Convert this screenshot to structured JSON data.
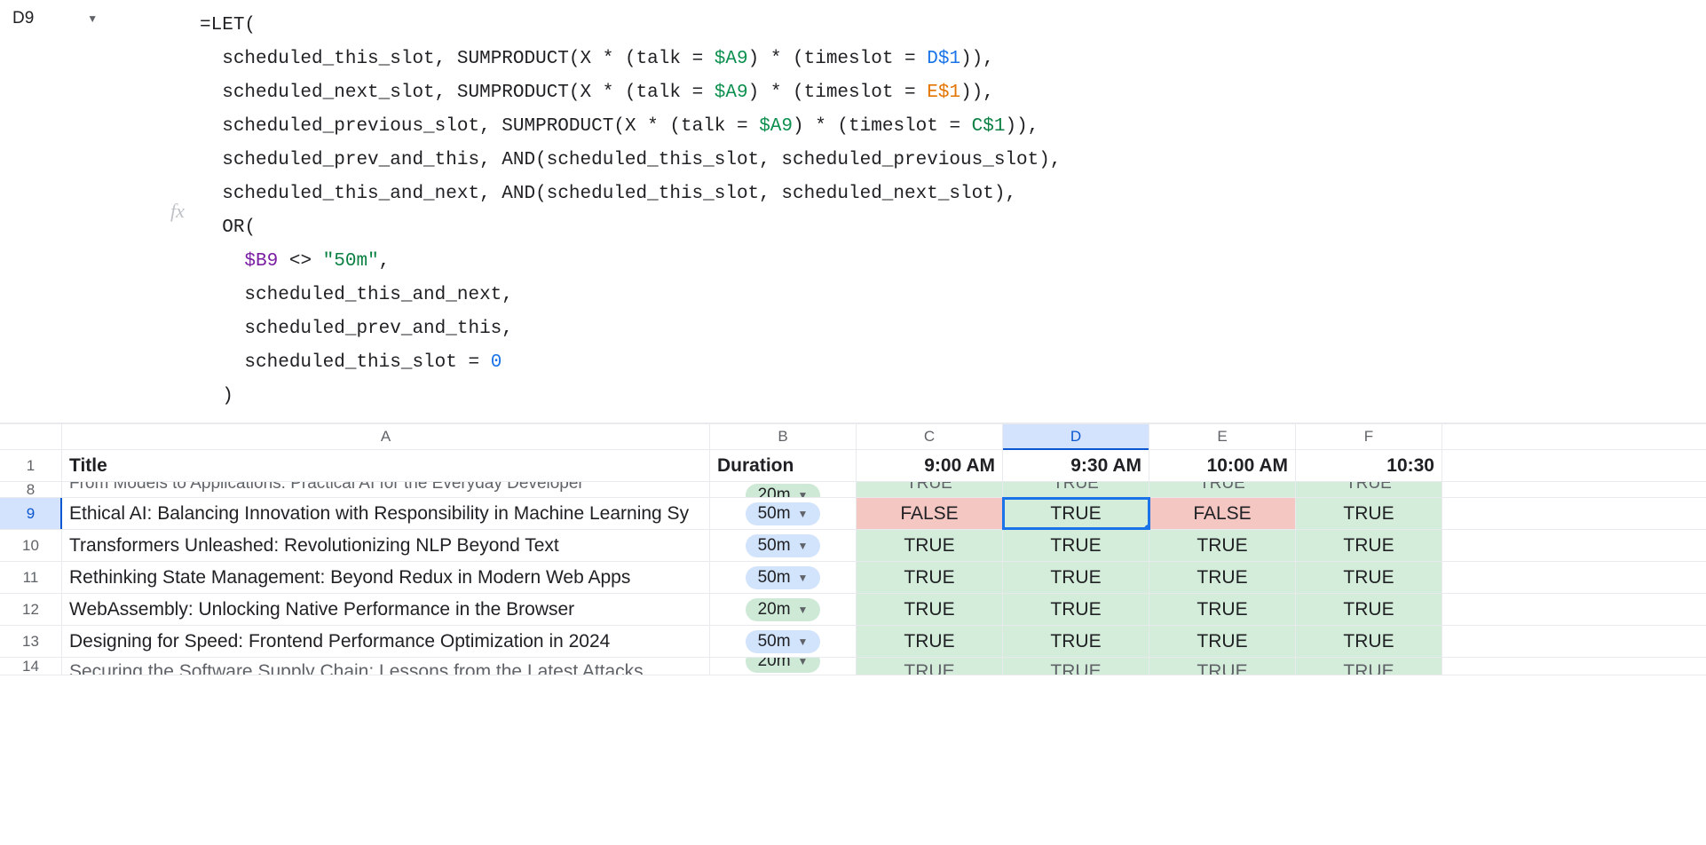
{
  "name_box": "D9",
  "formula": {
    "lines": [
      {
        "indent": 0,
        "parts": [
          {
            "t": "op",
            "v": "="
          },
          {
            "t": "fn",
            "v": "LET"
          },
          {
            "t": "op",
            "v": "("
          }
        ]
      },
      {
        "indent": 1,
        "parts": [
          {
            "t": "var",
            "v": "scheduled_this_slot"
          },
          {
            "t": "op",
            "v": ", "
          },
          {
            "t": "fn",
            "v": "SUMPRODUCT"
          },
          {
            "t": "op",
            "v": "("
          },
          {
            "t": "var",
            "v": "X"
          },
          {
            "t": "op",
            "v": " * ("
          },
          {
            "t": "var",
            "v": "talk"
          },
          {
            "t": "op",
            "v": " = "
          },
          {
            "t": "cellref-teal",
            "v": "$A9"
          },
          {
            "t": "op",
            "v": ") * ("
          },
          {
            "t": "var",
            "v": "timeslot"
          },
          {
            "t": "op",
            "v": " = "
          },
          {
            "t": "cellref-blue",
            "v": "D$1"
          },
          {
            "t": "op",
            "v": ")),"
          }
        ]
      },
      {
        "indent": 1,
        "parts": [
          {
            "t": "var",
            "v": "scheduled_next_slot"
          },
          {
            "t": "op",
            "v": ", "
          },
          {
            "t": "fn",
            "v": "SUMPRODUCT"
          },
          {
            "t": "op",
            "v": "("
          },
          {
            "t": "var",
            "v": "X"
          },
          {
            "t": "op",
            "v": " * ("
          },
          {
            "t": "var",
            "v": "talk"
          },
          {
            "t": "op",
            "v": " = "
          },
          {
            "t": "cellref-teal",
            "v": "$A9"
          },
          {
            "t": "op",
            "v": ") * ("
          },
          {
            "t": "var",
            "v": "timeslot"
          },
          {
            "t": "op",
            "v": " = "
          },
          {
            "t": "cellref-gold",
            "v": "E$1"
          },
          {
            "t": "op",
            "v": ")),"
          }
        ]
      },
      {
        "indent": 1,
        "parts": [
          {
            "t": "var",
            "v": "scheduled_previous_slot"
          },
          {
            "t": "op",
            "v": ", "
          },
          {
            "t": "fn",
            "v": "SUMPRODUCT"
          },
          {
            "t": "op",
            "v": "("
          },
          {
            "t": "var",
            "v": "X"
          },
          {
            "t": "op",
            "v": " * ("
          },
          {
            "t": "var",
            "v": "talk"
          },
          {
            "t": "op",
            "v": " = "
          },
          {
            "t": "cellref-teal",
            "v": "$A9"
          },
          {
            "t": "op",
            "v": ") * ("
          },
          {
            "t": "var",
            "v": "timeslot"
          },
          {
            "t": "op",
            "v": " = "
          },
          {
            "t": "cellref-green",
            "v": "C$1"
          },
          {
            "t": "op",
            "v": ")),"
          }
        ]
      },
      {
        "indent": 1,
        "parts": [
          {
            "t": "var",
            "v": "scheduled_prev_and_this"
          },
          {
            "t": "op",
            "v": ", "
          },
          {
            "t": "fn",
            "v": "AND"
          },
          {
            "t": "op",
            "v": "("
          },
          {
            "t": "var",
            "v": "scheduled_this_slot"
          },
          {
            "t": "op",
            "v": ", "
          },
          {
            "t": "var",
            "v": "scheduled_previous_slot"
          },
          {
            "t": "op",
            "v": "),"
          }
        ]
      },
      {
        "indent": 1,
        "parts": [
          {
            "t": "var",
            "v": "scheduled_this_and_next"
          },
          {
            "t": "op",
            "v": ", "
          },
          {
            "t": "fn",
            "v": "AND"
          },
          {
            "t": "op",
            "v": "("
          },
          {
            "t": "var",
            "v": "scheduled_this_slot"
          },
          {
            "t": "op",
            "v": ", "
          },
          {
            "t": "var",
            "v": "scheduled_next_slot"
          },
          {
            "t": "op",
            "v": "),"
          }
        ]
      },
      {
        "indent": 1,
        "parts": [
          {
            "t": "fn",
            "v": "OR"
          },
          {
            "t": "op",
            "v": "("
          }
        ]
      },
      {
        "indent": 2,
        "parts": [
          {
            "t": "cellref-purple",
            "v": "$B9"
          },
          {
            "t": "op",
            "v": " <> "
          },
          {
            "t": "str",
            "v": "\"50m\""
          },
          {
            "t": "op",
            "v": ","
          }
        ]
      },
      {
        "indent": 2,
        "parts": [
          {
            "t": "var",
            "v": "scheduled_this_and_next"
          },
          {
            "t": "op",
            "v": ","
          }
        ]
      },
      {
        "indent": 2,
        "parts": [
          {
            "t": "var",
            "v": "scheduled_prev_and_this"
          },
          {
            "t": "op",
            "v": ","
          }
        ]
      },
      {
        "indent": 2,
        "parts": [
          {
            "t": "var",
            "v": "scheduled_this_slot"
          },
          {
            "t": "op",
            "v": " = "
          },
          {
            "t": "num",
            "v": "0"
          }
        ]
      },
      {
        "indent": 1,
        "parts": [
          {
            "t": "op",
            "v": ")"
          }
        ]
      }
    ]
  },
  "columns": [
    "A",
    "B",
    "C",
    "D",
    "E",
    "F"
  ],
  "selected_column": "D",
  "header_row": {
    "num": "1",
    "title": "Title",
    "duration": "Duration",
    "c": "9:00 AM",
    "d": "9:30 AM",
    "e": "10:00 AM",
    "f": "10:30"
  },
  "clipped_row": {
    "num": "8",
    "title": "From Models to Applications: Practical AI for the Everyday Developer",
    "duration": "20m",
    "c": "TRUE",
    "d": "TRUE",
    "e": "TRUE",
    "f": "TRUE"
  },
  "rows": [
    {
      "num": "9",
      "selected": true,
      "title": "Ethical AI: Balancing Innovation with Responsibility in Machine Learning Sy",
      "duration": "50m",
      "dur_color": "blue",
      "c": "FALSE",
      "d": "TRUE",
      "e": "FALSE",
      "f": "TRUE",
      "active_col": "d"
    },
    {
      "num": "10",
      "title": "Transformers Unleashed: Revolutionizing NLP Beyond Text",
      "duration": "50m",
      "dur_color": "blue",
      "c": "TRUE",
      "d": "TRUE",
      "e": "TRUE",
      "f": "TRUE"
    },
    {
      "num": "11",
      "title": "Rethinking State Management: Beyond Redux in Modern Web Apps",
      "duration": "50m",
      "dur_color": "blue",
      "c": "TRUE",
      "d": "TRUE",
      "e": "TRUE",
      "f": "TRUE"
    },
    {
      "num": "12",
      "title": "WebAssembly: Unlocking Native Performance in the Browser",
      "duration": "20m",
      "dur_color": "green",
      "c": "TRUE",
      "d": "TRUE",
      "e": "TRUE",
      "f": "TRUE"
    },
    {
      "num": "13",
      "title": "Designing for Speed: Frontend Performance Optimization in 2024",
      "duration": "50m",
      "dur_color": "blue",
      "c": "TRUE",
      "d": "TRUE",
      "e": "TRUE",
      "f": "TRUE"
    }
  ],
  "partial_row": {
    "num": "14",
    "title": "Securing the Software Supply Chain: Lessons from the Latest Attacks",
    "duration": "20m",
    "c": "TRUE",
    "d": "TRUE",
    "e": "TRUE",
    "f": "TRUE"
  }
}
